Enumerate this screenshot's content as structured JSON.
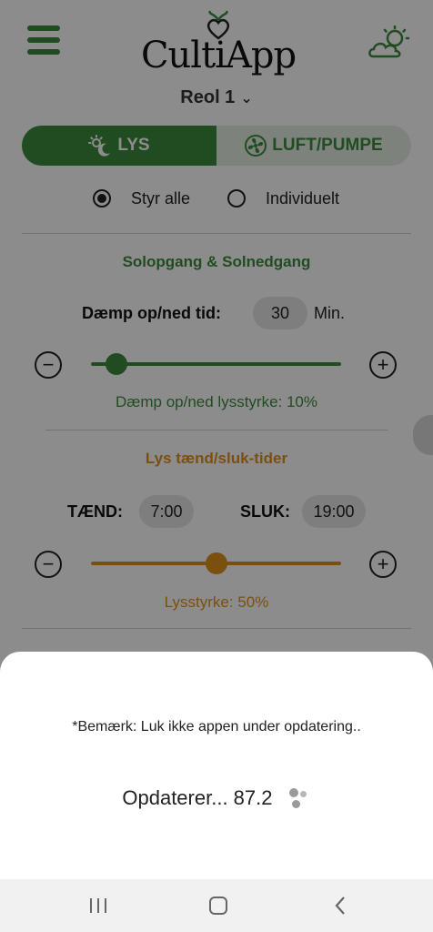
{
  "header": {
    "app_name": "CultiApp",
    "icons": {
      "menu": "hamburger-menu-icon",
      "weather": "partly-cloudy-icon",
      "logo_mark": "heart-sprout-icon"
    }
  },
  "shelf": {
    "label": "Reol 1",
    "icon": "chevron-down-icon"
  },
  "tabs": [
    {
      "label": "LYS",
      "icon": "sun-moon-icon",
      "active": true
    },
    {
      "label": "LUFT/PUMPE",
      "icon": "fan-icon",
      "active": false
    }
  ],
  "control_mode": {
    "options": [
      {
        "label": "Styr alle",
        "selected": true
      },
      {
        "label": "Individuelt",
        "selected": false
      }
    ]
  },
  "sunrise": {
    "title": "Solopgang & Solnedgang",
    "dim_time_label": "Dæmp op/ned tid:",
    "dim_time_value": "30",
    "dim_time_unit": "Min.",
    "brightness_caption": "Dæmp op/ned lysstyrke: 10%",
    "brightness_fraction": 0.1
  },
  "light_times": {
    "title": "Lys tænd/sluk-tider",
    "on_label": "TÆND:",
    "on_value": "7:00",
    "off_label": "SLUK:",
    "off_value": "19:00",
    "brightness_caption": "Lysstyrke: 50%",
    "brightness_fraction": 0.5
  },
  "update_sheet": {
    "note": "*Bemærk: Luk ikke appen under opdatering..",
    "progress_text": "Opdaterer... 87.2"
  },
  "colors": {
    "primary_green": "#3d8b3d",
    "accent_orange": "#e0921b",
    "overlay": "rgba(0,0,0,0.45)"
  },
  "system_nav": {
    "icons": [
      "recent-apps-icon",
      "home-icon",
      "back-icon"
    ]
  }
}
